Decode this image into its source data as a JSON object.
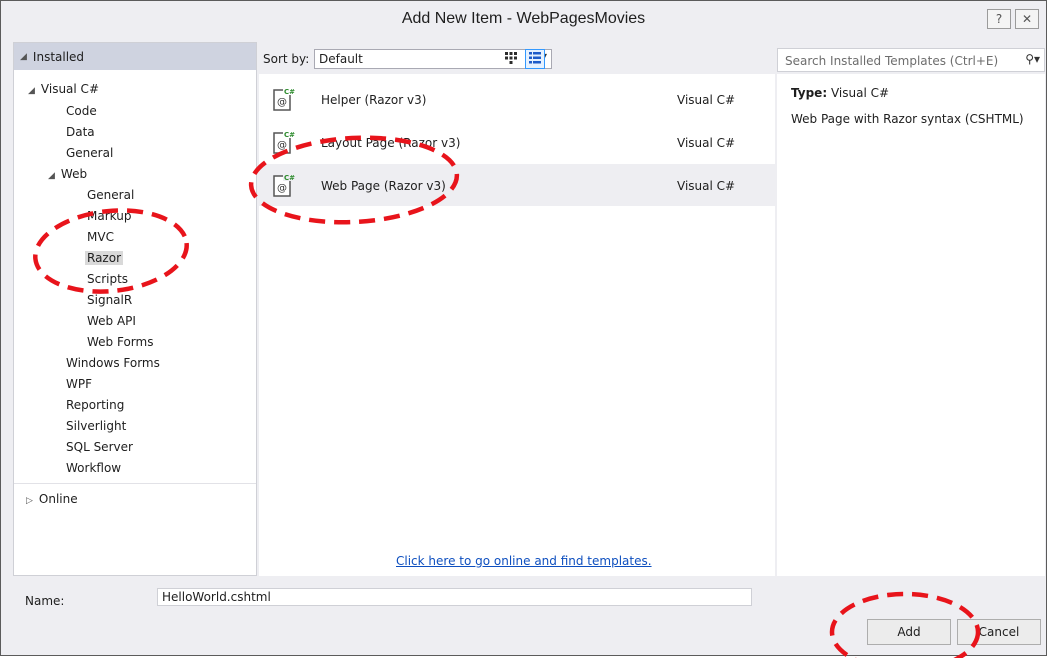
{
  "window": {
    "title": "Add New Item - WebPagesMovies",
    "help_glyph": "?",
    "close_glyph": "✕"
  },
  "tree": {
    "installed_label": "Installed",
    "visual_csharp": "Visual C#",
    "code": "Code",
    "data": "Data",
    "general": "General",
    "web": "Web",
    "web_children": [
      "General",
      "Markup",
      "MVC",
      "Razor",
      "Scripts",
      "SignalR",
      "Web API",
      "Web Forms"
    ],
    "after_web": [
      "Windows Forms",
      "WPF",
      "Reporting",
      "Silverlight",
      "SQL Server",
      "Workflow"
    ],
    "online_label": "Online",
    "selected": "Razor"
  },
  "toolbar": {
    "sort_label": "Sort by:",
    "sort_value": "Default"
  },
  "templates": [
    {
      "name": "Helper (Razor v3)",
      "lang": "Visual C#"
    },
    {
      "name": "Layout Page (Razor v3)",
      "lang": "Visual C#"
    },
    {
      "name": "Web Page (Razor v3)",
      "lang": "Visual C#"
    }
  ],
  "online_link": "Click here to go online and find templates.",
  "search": {
    "placeholder": "Search Installed Templates (Ctrl+E)"
  },
  "details": {
    "type_label": "Type:",
    "type_value": "Visual C#",
    "description": "Web Page with Razor syntax (CSHTML)"
  },
  "bottom": {
    "name_label": "Name:",
    "name_value": "HelloWorld.cshtml",
    "add_label": "Add",
    "cancel_label": "Cancel"
  },
  "colors": {
    "annotation": "#e8141b",
    "link": "#0e4fbf",
    "selected_row": "#eeeef2"
  }
}
